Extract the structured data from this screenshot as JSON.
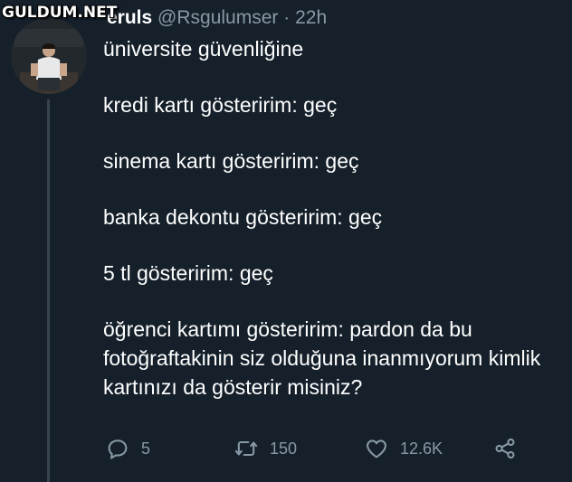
{
  "watermark": "GULDUM.NET",
  "tweet": {
    "display_name": "eruls",
    "handle": "@Rsgulumser",
    "separator": "·",
    "time": "22h",
    "paragraphs": [
      "üniversite güvenliğine",
      "kredi kartı gösteririm: geç",
      "sinema kartı gösteririm: geç",
      "banka dekontu gösteririm: geç",
      "5 tl gösteririm: geç",
      "öğrenci kartımı gösteririm: pardon da bu fotoğraftakinin siz olduğuna inanmıyorum kimlik kartınızı da gösterir misiniz?"
    ]
  },
  "actions": {
    "reply": {
      "icon": "reply-icon",
      "count": "5"
    },
    "retweet": {
      "icon": "retweet-icon",
      "count": "150"
    },
    "like": {
      "icon": "heart-icon",
      "count": "12.6K"
    },
    "share": {
      "icon": "share-icon"
    }
  },
  "colors": {
    "background": "#15202b",
    "text": "#ffffff",
    "muted": "#8899a6",
    "thread_line": "#38444d"
  }
}
